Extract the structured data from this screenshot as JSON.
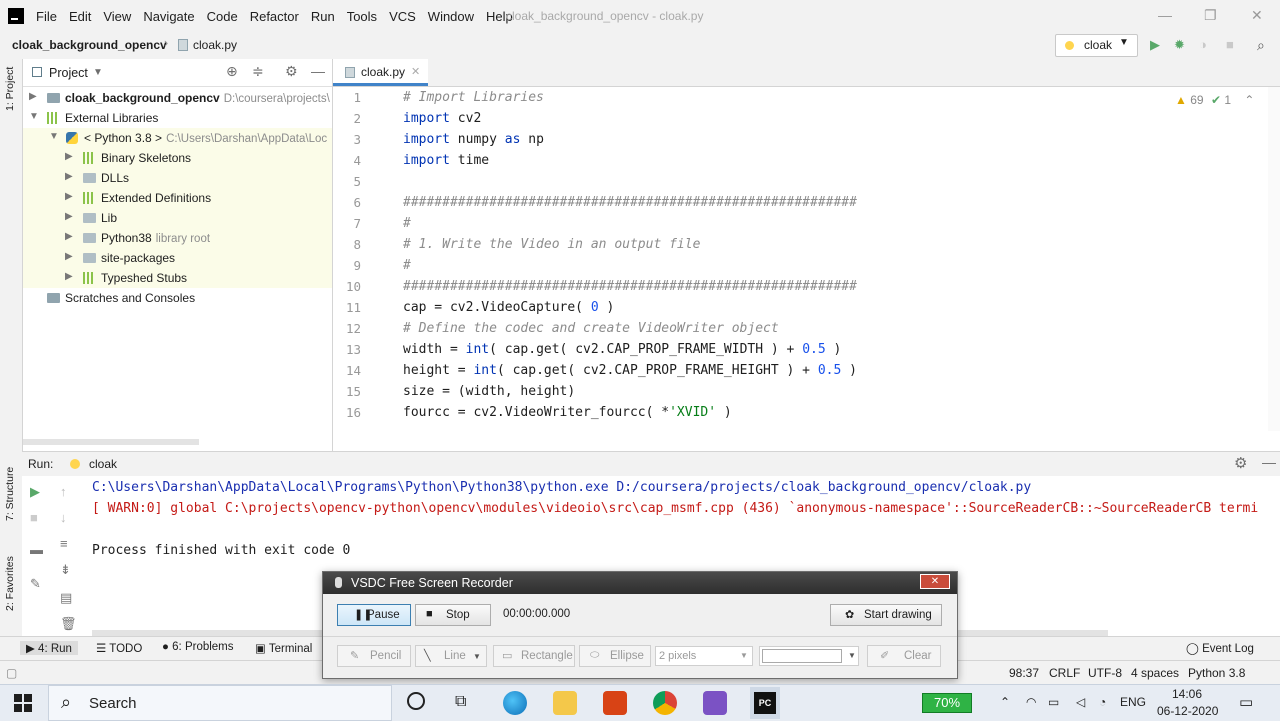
{
  "menubar": {
    "items": [
      "File",
      "Edit",
      "View",
      "Navigate",
      "Code",
      "Refactor",
      "Run",
      "Tools",
      "VCS",
      "Window",
      "Help"
    ],
    "window_title": "cloak_background_opencv - cloak.py"
  },
  "navbar": {
    "project": "cloak_background_opencv",
    "file": "cloak.py",
    "run_config": "cloak"
  },
  "left_strip": {
    "project_tab": "1: Project",
    "structure_tab": "7: Structure",
    "favorites_tab": "2: Favorites"
  },
  "project_panel": {
    "title": "Project",
    "tree": [
      {
        "label": "cloak_background_opencv",
        "hint": "D:\\coursera\\projects\\"
      },
      {
        "label": "External Libraries",
        "hint": ""
      },
      {
        "label": "< Python 3.8 >",
        "hint": "C:\\Users\\Darshan\\AppData\\Loc"
      },
      {
        "label": "Binary Skeletons",
        "hint": ""
      },
      {
        "label": "DLLs",
        "hint": ""
      },
      {
        "label": "Extended Definitions",
        "hint": ""
      },
      {
        "label": "Lib",
        "hint": ""
      },
      {
        "label": "Python38",
        "hint": "library root"
      },
      {
        "label": "site-packages",
        "hint": ""
      },
      {
        "label": "Typeshed Stubs",
        "hint": ""
      },
      {
        "label": "Scratches and Consoles",
        "hint": ""
      }
    ]
  },
  "editor": {
    "tab": "cloak.py",
    "warnings": "69",
    "checks": "1",
    "line_numbers": [
      "1",
      "2",
      "3",
      "4",
      "5",
      "6",
      "7",
      "8",
      "9",
      "10",
      "11",
      "12",
      "13",
      "14",
      "15",
      "16"
    ],
    "code": {
      "l1": "# Import Libraries",
      "l2_kw": "import",
      "l2": " cv2",
      "l3_kw": "import",
      "l3a": " numpy ",
      "l3_as": "as",
      "l3b": " np",
      "l4_kw": "import",
      "l4": " time",
      "l6": "##########################################################",
      "l7": "#",
      "l8": "# 1. Write the Video in an output file",
      "l9": "#",
      "l10": "##########################################################",
      "l11a": "cap = cv2.VideoCapture( ",
      "l11n": "0",
      "l11b": " )",
      "l12": "# Define the codec and create VideoWriter object",
      "l13a": "width = ",
      "l13kw": "int",
      "l13b": "( cap.get( cv2.CAP_PROP_FRAME_WIDTH ) + ",
      "l13n": "0.5",
      "l13c": " )",
      "l14a": "height = ",
      "l14kw": "int",
      "l14b": "( cap.get( cv2.CAP_PROP_FRAME_HEIGHT ) + ",
      "l14n": "0.5",
      "l14c": " )",
      "l15": "size = (width, height)",
      "l16a": "fourcc = cv2.VideoWriter_fourcc( *",
      "l16s": "'XVID'",
      "l16b": " )"
    }
  },
  "run_panel": {
    "label": "Run:",
    "tab": "cloak",
    "lines": [
      "C:\\Users\\Darshan\\AppData\\Local\\Programs\\Python\\Python38\\python.exe D:/coursera/projects/cloak_background_opencv/cloak.py",
      "[ WARN:0] global C:\\projects\\opencv-python\\opencv\\modules\\videoio\\src\\cap_msmf.cpp (436) `anonymous-namespace'::SourceReaderCB::~SourceReaderCB termi",
      "Process finished with exit code 0"
    ]
  },
  "bottom_tabs": {
    "run": "4: Run",
    "todo": "TODO",
    "problems": "6: Problems",
    "terminal": "Terminal",
    "event_log": "Event Log"
  },
  "status_bar": {
    "position": "98:37",
    "line_sep": "CRLF",
    "encoding": "UTF-8",
    "indent": "4 spaces",
    "interpreter": "Python 3.8"
  },
  "recorder": {
    "title": "VSDC Free Screen Recorder",
    "pause": "Pause",
    "stop": "Stop",
    "timer": "00:00:00.000",
    "start_drawing": "Start drawing",
    "pencil": "Pencil",
    "line": "Line",
    "rectangle": "Rectangle",
    "ellipse": "Ellipse",
    "thickness": "2 pixels",
    "clear": "Clear"
  },
  "taskbar": {
    "search": "Search",
    "battery": "70%",
    "language": "ENG",
    "time": "14:06",
    "date": "06-12-2020"
  }
}
